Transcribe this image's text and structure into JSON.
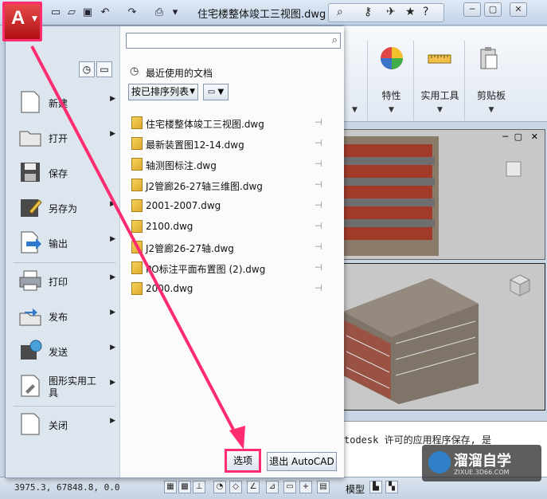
{
  "window": {
    "title": "住宅楼整体竣工三视图.dwg"
  },
  "app_button": {
    "label": "A"
  },
  "search": {
    "placeholder": ""
  },
  "left_menu": [
    {
      "label": "新建",
      "icon": "new-doc-icon"
    },
    {
      "label": "打开",
      "icon": "folder-open-icon"
    },
    {
      "label": "保存",
      "icon": "save-icon"
    },
    {
      "label": "另存为",
      "icon": "save-as-icon"
    },
    {
      "label": "输出",
      "icon": "export-icon"
    },
    {
      "label": "打印",
      "icon": "printer-icon"
    },
    {
      "label": "发布",
      "icon": "publish-icon"
    },
    {
      "label": "发送",
      "icon": "send-icon"
    },
    {
      "label": "图形实用工具",
      "icon": "drawing-utilities-icon"
    },
    {
      "label": "关闭",
      "icon": "close-doc-icon"
    }
  ],
  "recent": {
    "title": "最近使用的文档",
    "sort_label": "按已排序列表",
    "files": [
      "住宅楼整体竣工三视图.dwg",
      "最新装置图12-14.dwg",
      "轴测图标注.dwg",
      "J2管廊26-27轴三维图.dwg",
      "2001-2007.dwg",
      "2100.dwg",
      "J2管廊26-27轴.dwg",
      "PO标注平面布置图 (2).dwg",
      "2000.dwg"
    ]
  },
  "buttons": {
    "options": "选项",
    "exit": "退出 AutoCAD"
  },
  "ribbon": {
    "groups": [
      "特性",
      "实用工具",
      "剪贴板"
    ]
  },
  "command_line": {
    "text": "todesk 许可的应用程序保存, 是"
  },
  "status_bar": {
    "coords": "3975.3,   67848.8, 0.0",
    "model": "模型"
  },
  "watermark": {
    "main": "溜溜自学",
    "sub": "ZIXUE.3D66.COM"
  },
  "accent": {
    "highlight": "#ff2d6f",
    "file_icon": "#e0a92a"
  }
}
